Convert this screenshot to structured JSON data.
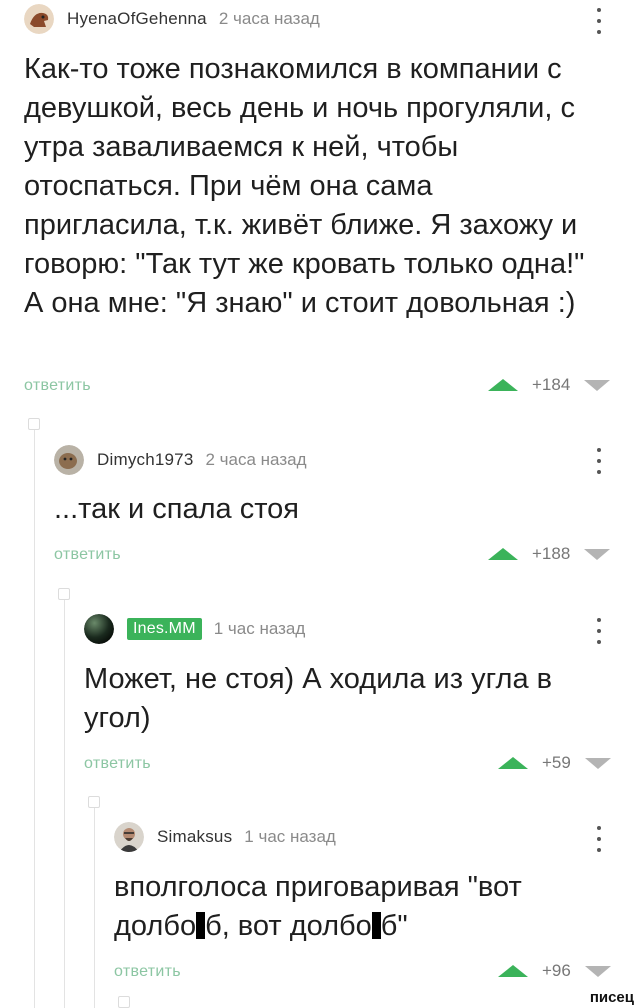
{
  "comments": [
    {
      "author": "HyenaOfGehenna",
      "time": "2 часа назад",
      "body": "Как-то тоже познакомился в компании с девушкой, весь день и ночь прогуляли, с утра заваливаемся к ней, чтобы отоспаться. При чём она сама пригласила, т.к. живёт ближе. Я захожу и говорю: \"Так тут же кровать только одна!\" А она мне: \"Я знаю\" и стоит довольная :)",
      "reply": "ответить",
      "score": "+184"
    },
    {
      "author": "Dimych1973",
      "time": "2 часа назад",
      "body": "...так и спала стоя",
      "reply": "ответить",
      "score": "+188"
    },
    {
      "author": "Ines.MM",
      "time": "1 час назад",
      "body": "Может, не стоя) А ходила из угла в угол)",
      "reply": "ответить",
      "score": "+59"
    },
    {
      "author": "Simaksus",
      "time": "1 час назад",
      "body_parts": [
        "вполголоса приговаривая \"вот долбо",
        "б, вот долбо",
        "б\""
      ],
      "reply": "ответить",
      "score": "+96"
    }
  ],
  "watermark": "писец"
}
